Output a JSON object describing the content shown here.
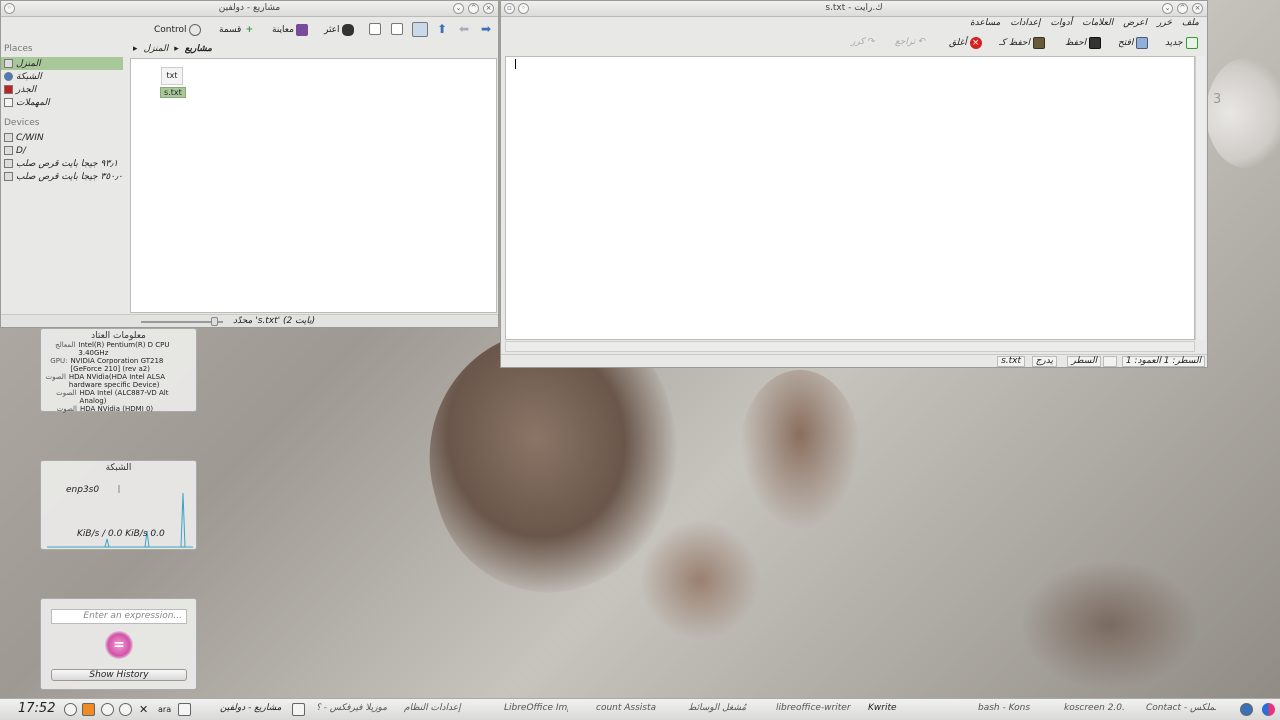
{
  "desktop": {
    "clock_widget_number": "3"
  },
  "dolphin": {
    "title": "مشاريع - دولفين",
    "toolbar": {
      "control_label": "Control",
      "split_label": "قسمة",
      "preview_label": "معاينة",
      "find_label": "اعثر"
    },
    "breadcrumb": {
      "home": "المنزل",
      "projects": "مشاريع"
    },
    "places": {
      "header": "Places",
      "items": [
        {
          "label": "المنزل",
          "icon": "home-icon"
        },
        {
          "label": "الشبكة",
          "icon": "network-icon"
        },
        {
          "label": "الجذر",
          "icon": "root-folder-icon"
        },
        {
          "label": "المهملات",
          "icon": "trash-icon"
        }
      ]
    },
    "devices": {
      "header": "Devices",
      "items": [
        {
          "label": "C/WIN"
        },
        {
          "label": "D/"
        },
        {
          "label": "٩٣٫١ جيجا بايت قرص صلب"
        },
        {
          "label": "٣٥٠٫٠ جيجا بايت قرص صلب"
        }
      ]
    },
    "file": {
      "icon_text": "txt",
      "name": "s.txt"
    },
    "status": "محدّد 's.txt' (2 بايت)"
  },
  "kwrite": {
    "title": "s.txt - ك.رايت",
    "menu": [
      "ملف",
      "حَرر",
      "اعرض",
      "العلامات",
      "أدوات",
      "إعدادات",
      "مساعدة"
    ],
    "toolbar": {
      "new": "جديد",
      "open": "افتح",
      "save": "احفظ",
      "save_as": "احفظ كـ",
      "close": "أغلق",
      "undo": "تراجع",
      "redo": "كرر"
    },
    "status": {
      "position": "السطر: 1 العمود: 1",
      "mode": "السطر",
      "insert": "يدرج",
      "filename": "s.txt"
    }
  },
  "widgets": {
    "sysinfo": {
      "title": "معلومات العتاد",
      "rows": [
        {
          "key": "المعالج",
          "value": "Intel(R) Pentium(R) D CPU 3.40GHz"
        },
        {
          "key": "GPU:",
          "value": "NVIDIA Corporation GT218 [GeForce 210] (rev a2)"
        },
        {
          "key": "الصوت",
          "value": "HDA NVidia(HDA Intel ALSA hardware specific Device)"
        },
        {
          "key": "الصوت",
          "value": "HDA Intel (ALC887-VD Alt Analog)"
        },
        {
          "key": "الصوت",
          "value": "HDA NVidia (HDMI 0)"
        }
      ]
    },
    "network": {
      "title": "الشبكة",
      "interface": "enp3s0",
      "rate": "KiB/s / 0.0 KiB/s 0.0"
    },
    "calculator": {
      "placeholder": "Enter an expression...",
      "history_button": "Show History"
    }
  },
  "taskbar": {
    "clock": "17:52",
    "lang": "ara",
    "tasks": [
      "مشاريع - دولفين",
      "موزيلا فيرفكس - ؟",
      "إعدادات النظام",
      "LibreOffice Impr",
      "count Assista",
      "مُشغل الوسائط",
      "libreoffice-writer",
      "Kwrite",
      "bash - Kons",
      "koscreen 2.0.",
      "Contact - الملكَس"
    ]
  }
}
